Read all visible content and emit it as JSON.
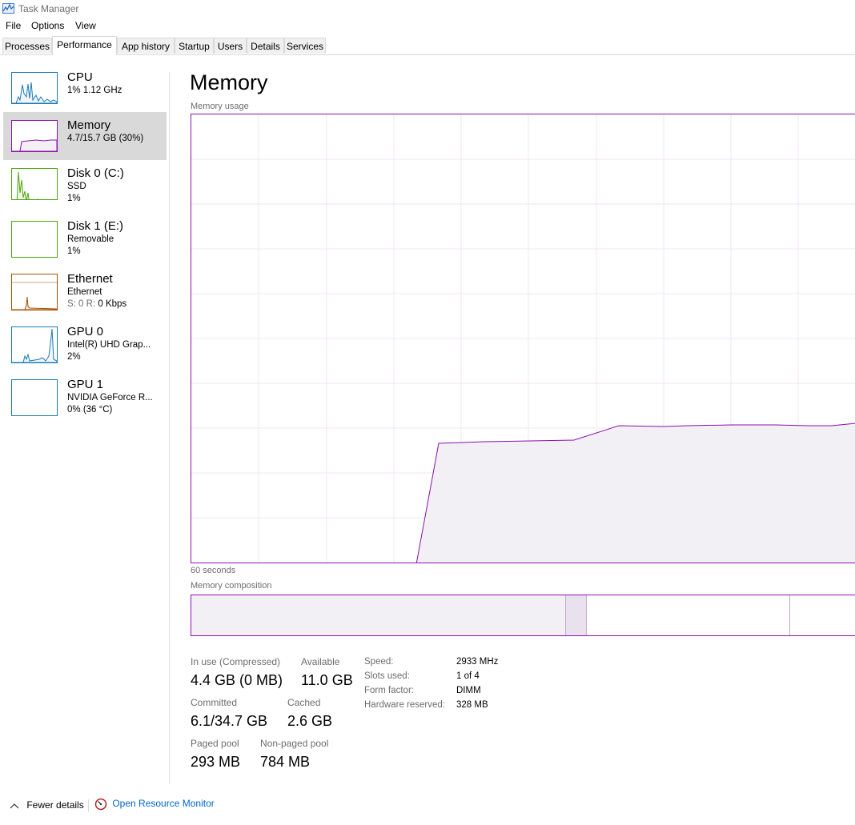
{
  "window": {
    "title": "Task Manager"
  },
  "menu": [
    "File",
    "Options",
    "View"
  ],
  "tabs": [
    "Processes",
    "Performance",
    "App history",
    "Startup",
    "Users",
    "Details",
    "Services"
  ],
  "active_tab": "Performance",
  "sidebar": [
    {
      "name": "CPU",
      "sub1": "1%  1.12 GHz",
      "sub2": "",
      "color": "#1a7ab8"
    },
    {
      "name": "Memory",
      "sub1": "4.7/15.7 GB (30%)",
      "sub2": "",
      "color": "#8b12ae",
      "selected": true
    },
    {
      "name": "Disk 0 (C:)",
      "sub1": "SSD",
      "sub2": "1%",
      "color": "#4da60c"
    },
    {
      "name": "Disk 1 (E:)",
      "sub1": "Removable",
      "sub2": "1%",
      "color": "#4da60c"
    },
    {
      "name": "Ethernet",
      "sub1": "Ethernet",
      "sub2_label": "S: 0  R: ",
      "sub2": "0 Kbps",
      "color": "#a74f01"
    },
    {
      "name": "GPU 0",
      "sub1": "Intel(R) UHD Grap...",
      "sub2": "2%",
      "color": "#1a7ab8"
    },
    {
      "name": "GPU 1",
      "sub1": "NVIDIA GeForce R...",
      "sub2": "0% (36 °C)",
      "color": "#1a7ab8"
    }
  ],
  "main": {
    "title": "Memory",
    "usage_label": "Memory usage",
    "time_label": "60 seconds",
    "composition_label": "Memory composition",
    "stats": {
      "in_use_label": "In use (Compressed)",
      "in_use_value": "4.4 GB (0 MB)",
      "available_label": "Available",
      "available_value": "11.0 GB",
      "committed_label": "Committed",
      "committed_value": "6.1/34.7 GB",
      "cached_label": "Cached",
      "cached_value": "2.6 GB",
      "paged_label": "Paged pool",
      "paged_value": "293 MB",
      "nonpaged_label": "Non-paged pool",
      "nonpaged_value": "784 MB"
    },
    "specs": [
      {
        "label": "Speed:",
        "value": "2933 MHz"
      },
      {
        "label": "Slots used:",
        "value": "1 of 4"
      },
      {
        "label": "Form factor:",
        "value": "DIMM"
      },
      {
        "label": "Hardware reserved:",
        "value": "328 MB"
      }
    ]
  },
  "footer": {
    "fewer_details": "Fewer details",
    "resource_monitor": "Open Resource Monitor"
  },
  "colors": {
    "memory_accent": "#8b12ae",
    "memory_fill": "#f2eff5"
  }
}
